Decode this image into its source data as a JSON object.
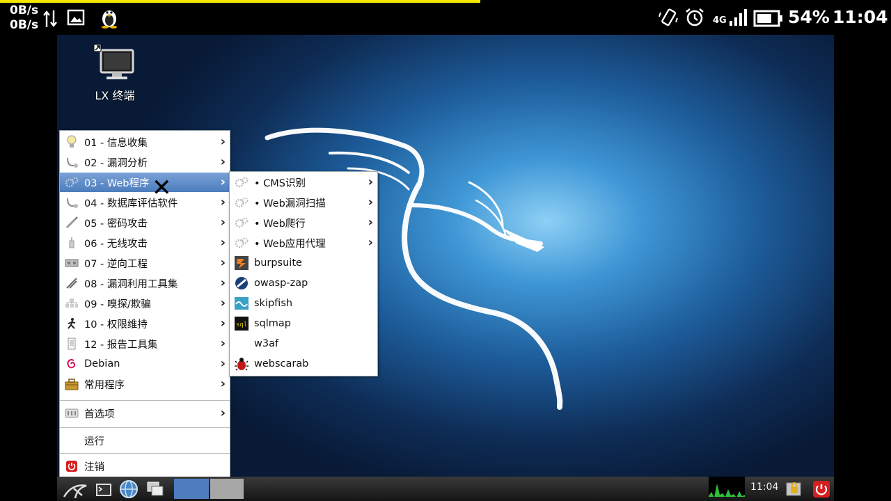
{
  "status_bar": {
    "net_speed_up": "0B/s",
    "net_speed_down": "0B/s",
    "network_type": "4G",
    "battery_percent": "54%",
    "time": "11:04"
  },
  "desktop": {
    "icons": [
      {
        "label": "LX 终端",
        "icon": "monitor-icon"
      }
    ]
  },
  "main_menu": {
    "items": [
      {
        "label": "01 - 信息收集",
        "icon": "lightbulb-icon",
        "has_submenu": true
      },
      {
        "label": "02 - 漏洞分析",
        "icon": "probe-icon",
        "has_submenu": true
      },
      {
        "label": "03 - Web程序",
        "icon": "gears-icon",
        "has_submenu": true,
        "selected": true
      },
      {
        "label": "04 - 数据库评估软件",
        "icon": "probe-icon",
        "has_submenu": true
      },
      {
        "label": "05 - 密码攻击",
        "icon": "pen-icon",
        "has_submenu": true
      },
      {
        "label": "06 - 无线攻击",
        "icon": "wireless-icon",
        "has_submenu": true
      },
      {
        "label": "07 - 逆向工程",
        "icon": "machine-icon",
        "has_submenu": true
      },
      {
        "label": "08 - 漏洞利用工具集",
        "icon": "tools-icon",
        "has_submenu": true
      },
      {
        "label": "09 - 嗅探/欺骗",
        "icon": "network-icon",
        "has_submenu": true
      },
      {
        "label": "10 - 权限维持",
        "icon": "runner-icon",
        "has_submenu": true
      },
      {
        "label": "12 - 报告工具集",
        "icon": "document-icon",
        "has_submenu": true
      },
      {
        "label": "Debian",
        "icon": "debian-swirl-icon",
        "has_submenu": true
      },
      {
        "label": "常用程序",
        "icon": "toolbox-icon",
        "has_submenu": true
      },
      {
        "label": "首选项",
        "icon": "preferences-icon",
        "has_submenu": true
      },
      {
        "label": "运行",
        "icon": "",
        "has_submenu": false
      },
      {
        "label": "注销",
        "icon": "power-icon",
        "has_submenu": false
      }
    ]
  },
  "web_submenu": {
    "items": [
      {
        "label": "• CMS识别",
        "icon": "gears-icon",
        "has_submenu": true
      },
      {
        "label": "• Web漏洞扫描",
        "icon": "gears-icon",
        "has_submenu": true
      },
      {
        "label": "• Web爬行",
        "icon": "gears-icon",
        "has_submenu": true
      },
      {
        "label": "• Web应用代理",
        "icon": "gears-icon",
        "has_submenu": true
      },
      {
        "label": "burpsuite",
        "icon": "burpsuite-icon",
        "has_submenu": false
      },
      {
        "label": "owasp-zap",
        "icon": "owasp-zap-icon",
        "has_submenu": false
      },
      {
        "label": "skipfish",
        "icon": "skipfish-icon",
        "has_submenu": false
      },
      {
        "label": "sqlmap",
        "icon": "sqlmap-icon",
        "has_submenu": false
      },
      {
        "label": "w3af",
        "icon": "",
        "has_submenu": false
      },
      {
        "label": "webscarab",
        "icon": "bug-icon",
        "has_submenu": false
      }
    ]
  },
  "taskbar": {
    "clock": "11:04"
  },
  "colors": {
    "menu_highlight": "#4d7dbd",
    "desktop_blue": "#1d5c9a",
    "load_bar": "#f5e800"
  }
}
